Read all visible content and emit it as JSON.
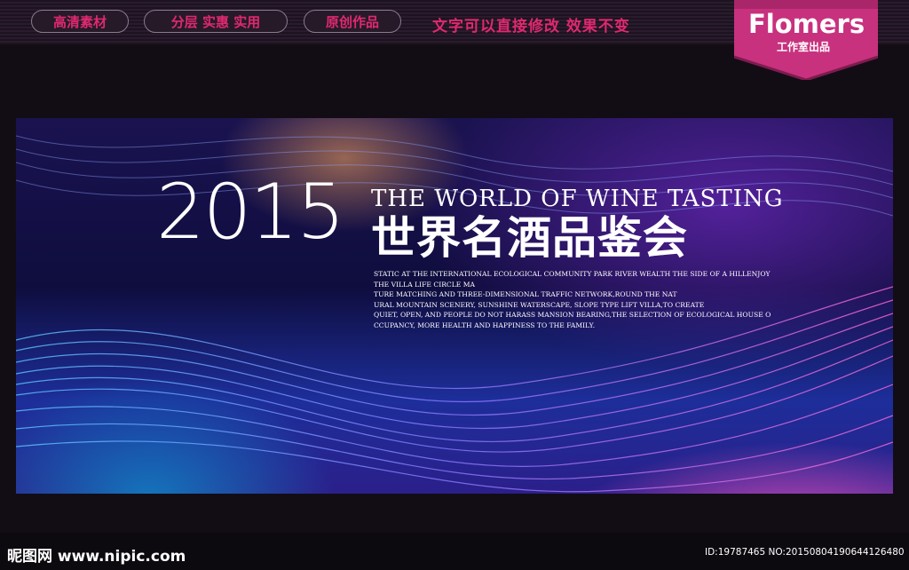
{
  "topbar": {
    "tags": [
      "高清素材",
      "分层 实惠 实用",
      "原创作品"
    ],
    "slogan": "文字可以直接修改  效果不变",
    "brand_title": "Flomers",
    "brand_sub": "工作室出品"
  },
  "banner": {
    "year": "2015",
    "title_en": "THE WORLD OF WINE TASTING",
    "title_cn": "世界名酒品鉴会",
    "body_lines": [
      "STATIC AT THE INTERNATIONAL ECOLOGICAL COMMUNITY PARK RIVER WEALTH THE SIDE OF A HILLENJOY",
      "THE VILLA LIFE CIRCLE MA",
      "TURE MATCHING AND THREE-DIMENSIONAL TRAFFIC NETWORK,ROUND THE NAT",
      "URAL MOUNTAIN SCENERY, SUNSHINE WATERSCAPE, SLOPE TYPE LIFT VILLA,TO CREATE",
      "QUIET, OPEN, AND PEOPLE DO NOT HARASS MANSION BEARING,THE SELECTION OF ECOLOGICAL HOUSE O",
      "CCUPANCY, MORE HEALTH AND HAPPINESS TO THE FAMILY."
    ]
  },
  "footer": {
    "site": "昵图网 www.nipic.com",
    "id_line": "ID:19787465 NO:20150804190644126480"
  },
  "colors": {
    "accent_pink": "#e0296f",
    "badge": "#c8317e",
    "page_bg": "#120d14"
  }
}
